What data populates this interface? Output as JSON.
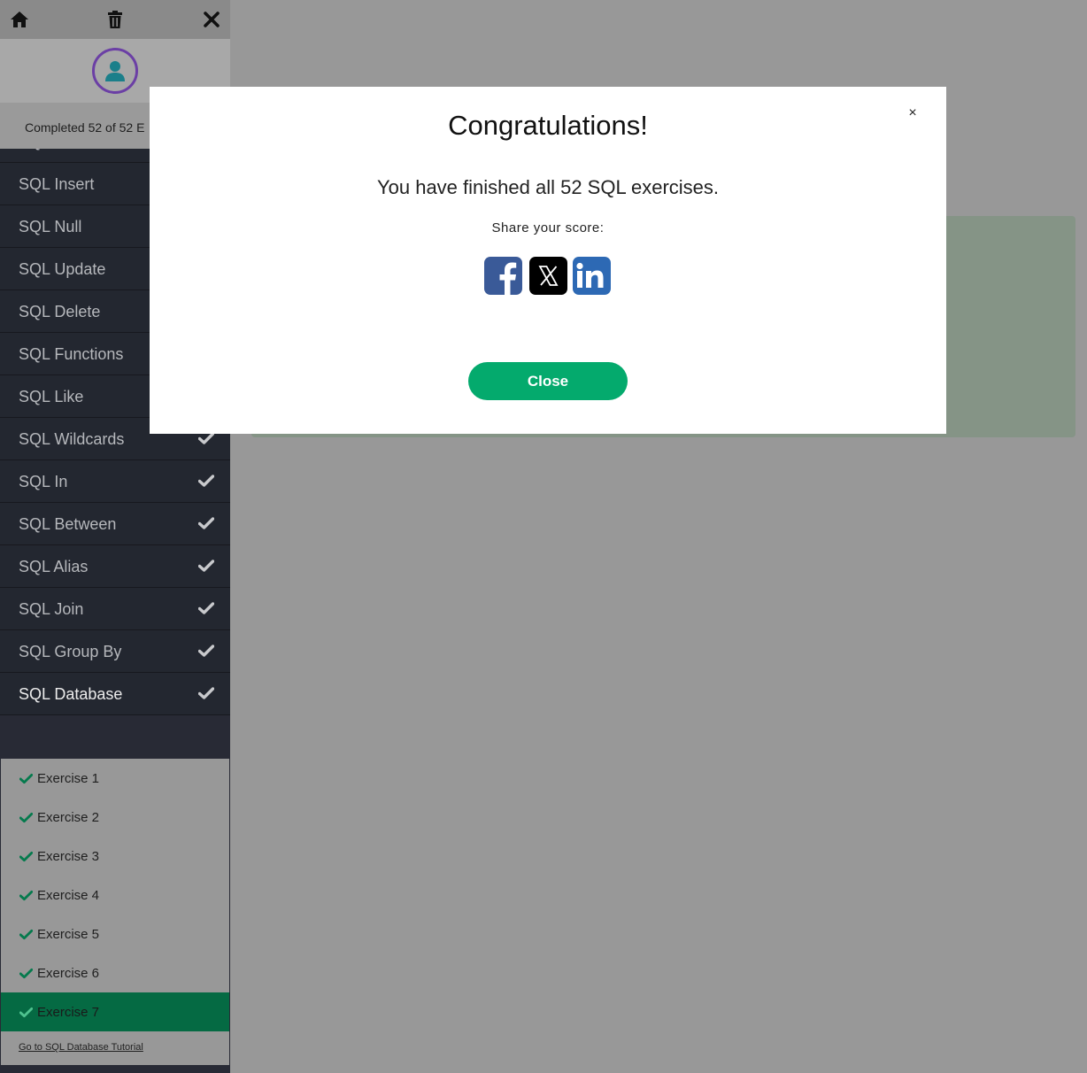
{
  "toolbar": {
    "home_icon": "home-icon",
    "delete_icon": "trash-icon",
    "close_icon": "close-icon"
  },
  "profile": {
    "avatar_icon": "user-avatar-icon",
    "progress_text": "Completed 52 of 52 E"
  },
  "sidebar": {
    "chapters": [
      {
        "label": "SQL Not",
        "completed": true
      },
      {
        "label": "SQL Insert",
        "completed": true
      },
      {
        "label": "SQL Null",
        "completed": true
      },
      {
        "label": "SQL Update",
        "completed": true
      },
      {
        "label": "SQL Delete",
        "completed": true
      },
      {
        "label": "SQL Functions",
        "completed": true
      },
      {
        "label": "SQL Like",
        "completed": true
      },
      {
        "label": "SQL Wildcards",
        "completed": true
      },
      {
        "label": "SQL In",
        "completed": true
      },
      {
        "label": "SQL Between",
        "completed": true
      },
      {
        "label": "SQL Alias",
        "completed": true
      },
      {
        "label": "SQL Join",
        "completed": true
      },
      {
        "label": "SQL Group By",
        "completed": true
      },
      {
        "label": "SQL Database",
        "completed": true
      }
    ],
    "exercises": [
      {
        "label": "Exercise 1"
      },
      {
        "label": "Exercise 2"
      },
      {
        "label": "Exercise 3"
      },
      {
        "label": "Exercise 4"
      },
      {
        "label": "Exercise 5"
      },
      {
        "label": "Exercise 6"
      },
      {
        "label": "Exercise 7"
      }
    ],
    "tutorial_link": "Go to SQL Database Tutorial"
  },
  "modal": {
    "close_x": "×",
    "title": "Congratulations!",
    "message": "You have finished all 52 SQL exercises.",
    "share_label": "Share your score:",
    "share_buttons": [
      "facebook-icon",
      "x-icon",
      "linkedin-icon"
    ],
    "close_button": "Close"
  },
  "colors": {
    "overlay": "#989898",
    "sidebar": "#282a35",
    "accent_green": "#04aa6d",
    "current_exercise": "#056a43",
    "avatar_ring": "#6b3fa5",
    "facebook": "#3a5a98",
    "linkedin": "#2d69b4"
  }
}
